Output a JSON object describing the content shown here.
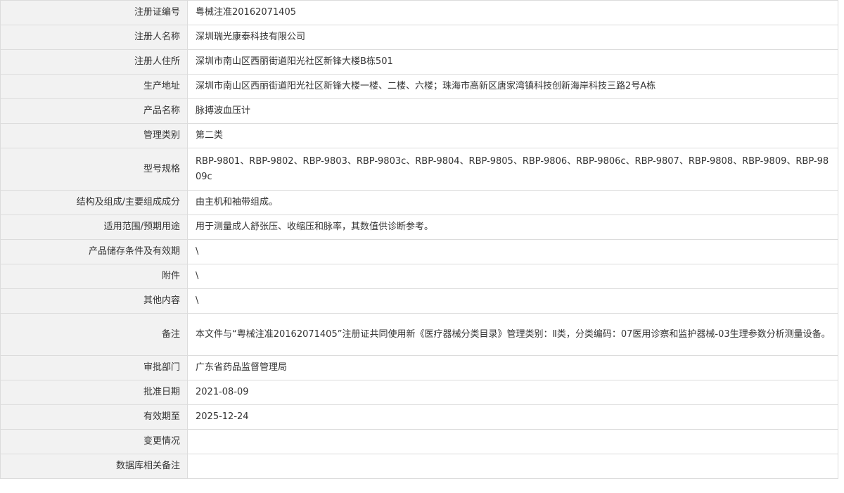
{
  "rows": [
    {
      "label": "注册证编号",
      "value": "粤械注准20162071405"
    },
    {
      "label": "注册人名称",
      "value": "深圳瑞光康泰科技有限公司"
    },
    {
      "label": "注册人住所",
      "value": "深圳市南山区西丽街道阳光社区新锋大楼B栋501"
    },
    {
      "label": "生产地址",
      "value": "深圳市南山区西丽街道阳光社区新锋大楼一楼、二楼、六楼；珠海市高新区唐家湾镇科技创新海岸科技三路2号A栋"
    },
    {
      "label": "产品名称",
      "value": "脉搏波血压计"
    },
    {
      "label": "管理类别",
      "value": "第二类"
    },
    {
      "label": "型号规格",
      "value": "RBP-9801、RBP-9802、RBP-9803、RBP-9803c、RBP-9804、RBP-9805、RBP-9806、RBP-9806c、RBP-9807、RBP-9808、RBP-9809、RBP-9809c"
    },
    {
      "label": "结构及组成/主要组成成分",
      "value": "由主机和袖带组成。"
    },
    {
      "label": "适用范围/预期用途",
      "value": "用于测量成人舒张压、收缩压和脉率，其数值供诊断参考。"
    },
    {
      "label": "产品储存条件及有效期",
      "value": "\\"
    },
    {
      "label": "附件",
      "value": "\\"
    },
    {
      "label": "其他内容",
      "value": "\\"
    },
    {
      "label": "备注",
      "value": "本文件与“粤械注准20162071405”注册证共同使用新《医疗器械分类目录》管理类别：Ⅱ类，分类编码：07医用诊察和监护器械-03生理参数分析测量设备。"
    },
    {
      "label": "审批部门",
      "value": "广东省药品监督管理局"
    },
    {
      "label": "批准日期",
      "value": "2021-08-09"
    },
    {
      "label": "有效期至",
      "value": "2025-12-24"
    },
    {
      "label": "变更情况",
      "value": ""
    },
    {
      "label": "数据库相关备注",
      "value": ""
    }
  ]
}
